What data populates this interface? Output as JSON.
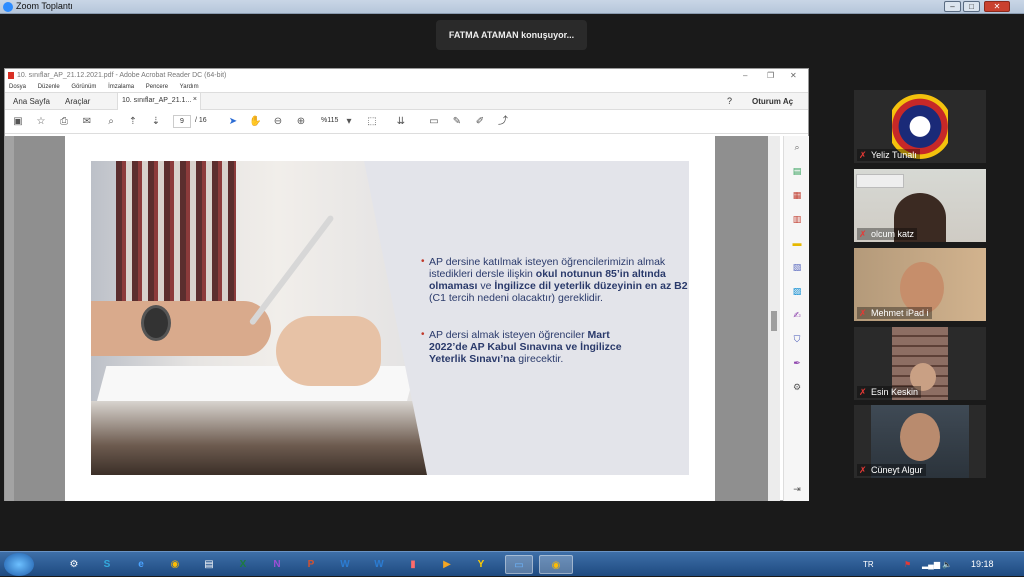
{
  "zoom": {
    "title": "Zoom Toplantı",
    "speaker": "FATMA ATAMAN konuşuyor..."
  },
  "acrobat": {
    "title": "10. sınıflar_AP_21.12.2021.pdf - Adobe Acrobat Reader DC (64-bit)",
    "menu": [
      "Dosya",
      "Düzenle",
      "Görünüm",
      "İmzalama",
      "Pencere",
      "Yardım"
    ],
    "tabs": {
      "home": "Ana Sayfa",
      "tools": "Araçlar",
      "doc": "10. sınıflar_AP_21.1..."
    },
    "signin": "Oturum Aç",
    "page_current": "9",
    "page_total": "/ 16",
    "zoom": "%115"
  },
  "slide": {
    "b1": {
      "pre": "AP dersine katılmak isteyen öğrencilerimizin almak istedikleri dersle ilişkin ",
      "bold1": "okul notunun 85’in altında olmaması",
      "mid": " ve ",
      "bold2": "İngilizce dil yeterlik düzeyinin en az B2",
      "post": " (C1 tercih nedeni olacaktır) gereklidir."
    },
    "b2": {
      "pre": "AP dersi almak isteyen öğrenciler ",
      "bold1": "Mart 2022’de AP Kabul Sınavına ve İngilizce Yeterlik Sınavı’na",
      "post": " girecektir."
    }
  },
  "participants": [
    {
      "name": "Yeliz Tunalı"
    },
    {
      "name": "olcum katz"
    },
    {
      "name": "Mehmet iPad i"
    },
    {
      "name": "Esin Keskin"
    },
    {
      "name": "Cüneyt Algur"
    }
  ],
  "taskbar": {
    "lang": "TR",
    "clock": "19:18"
  }
}
